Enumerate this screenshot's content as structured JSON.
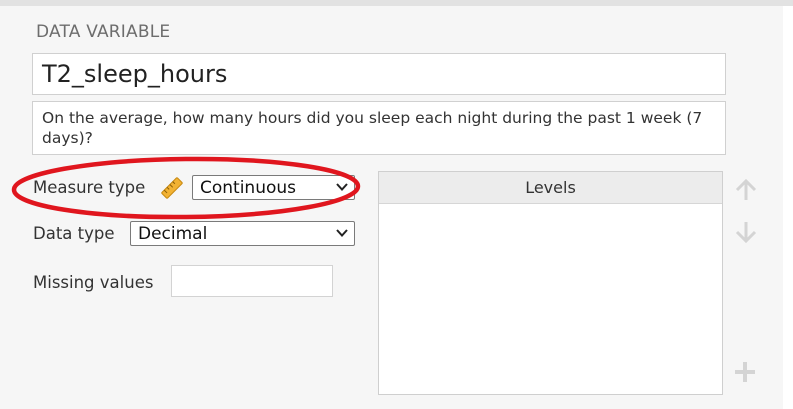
{
  "section_label": "DATA VARIABLE",
  "variable": {
    "name": "T2_sleep_hours",
    "description": "On the average, how many hours did you sleep each night during the past 1 week (7 days)?"
  },
  "measure_type": {
    "label": "Measure type",
    "icon": "ruler-icon",
    "value": "Continuous"
  },
  "data_type": {
    "label": "Data type",
    "value": "Decimal"
  },
  "missing_values": {
    "label": "Missing values",
    "value": ""
  },
  "levels": {
    "header": "Levels",
    "items": []
  },
  "colors": {
    "annotation": "#e0161e",
    "ruler": "#f2b233",
    "disabled_icon": "#d4d4d4"
  }
}
